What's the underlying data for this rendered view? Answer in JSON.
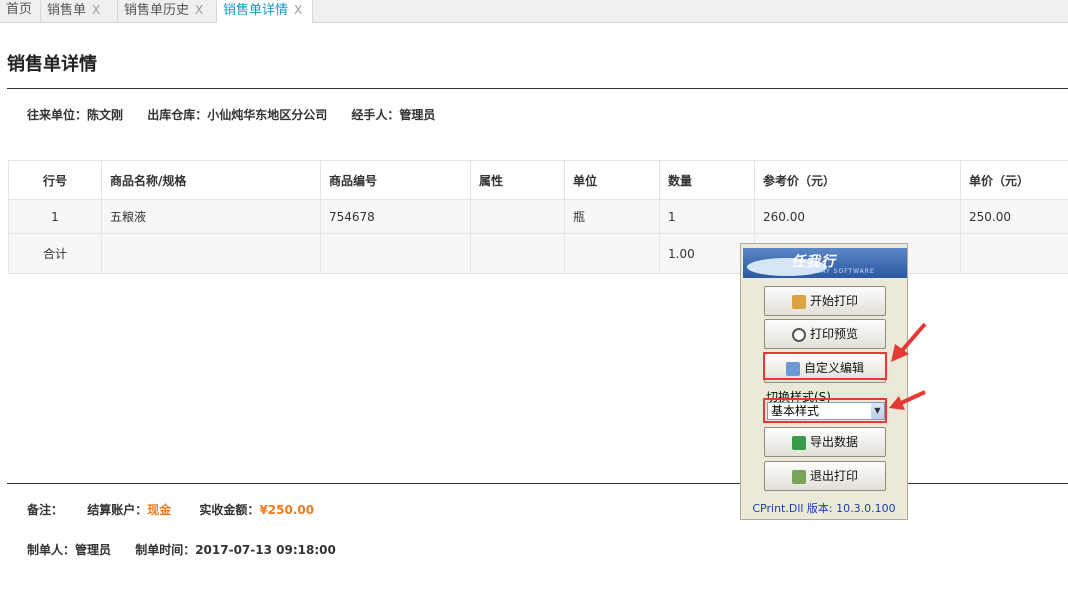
{
  "tabs": [
    {
      "label": "首页",
      "close": ""
    },
    {
      "label": "销售单",
      "close": "X"
    },
    {
      "label": "销售单历史",
      "close": "X"
    },
    {
      "label": "销售单详情",
      "close": "X"
    }
  ],
  "page_title": "销售单详情",
  "info": {
    "partner": "往来单位：陈文刚",
    "warehouse": "出库仓库：小仙炖华东地区分公司",
    "handler": "经手人：管理员"
  },
  "table": {
    "headers": [
      "行号",
      "商品名称/规格",
      "商品编号",
      "属性",
      "单位",
      "数量",
      "参考价（元）",
      "单价（元）"
    ],
    "rows": [
      [
        "1",
        "五粮液",
        "754678",
        "",
        "瓶",
        "1",
        "260.00",
        "250.00"
      ]
    ],
    "total": [
      "合计",
      "",
      "",
      "",
      "",
      "1.00",
      "",
      ""
    ]
  },
  "footer": {
    "note_label": "备注：",
    "account_label": "结算账户：",
    "account_value": "现金",
    "amount_label": "实收金额：",
    "amount_value": "¥250.00",
    "creator": "制单人：管理员",
    "create_time": "制单时间：2017-07-13 09:18:00"
  },
  "print_panel": {
    "logo_text": "任我行",
    "logo_sub": "WEWAY SOFTWARE",
    "buttons": [
      {
        "label": "开始打印",
        "icon": "printer-icon"
      },
      {
        "label": "打印预览",
        "icon": "magnifier-icon"
      },
      {
        "label": "自定义编辑",
        "icon": "edit-icon"
      },
      {
        "label": "导出数据",
        "icon": "excel-icon"
      },
      {
        "label": "退出打印",
        "icon": "exit-door-icon"
      }
    ],
    "switch_label": "切换样式(S)",
    "style_value": "基本样式",
    "version": "CPrint.Dll 版本: 10.3.0.100"
  },
  "colors": {
    "accent": "#1a97c4",
    "orange": "#f07b1f",
    "annotation": "#e53935"
  }
}
